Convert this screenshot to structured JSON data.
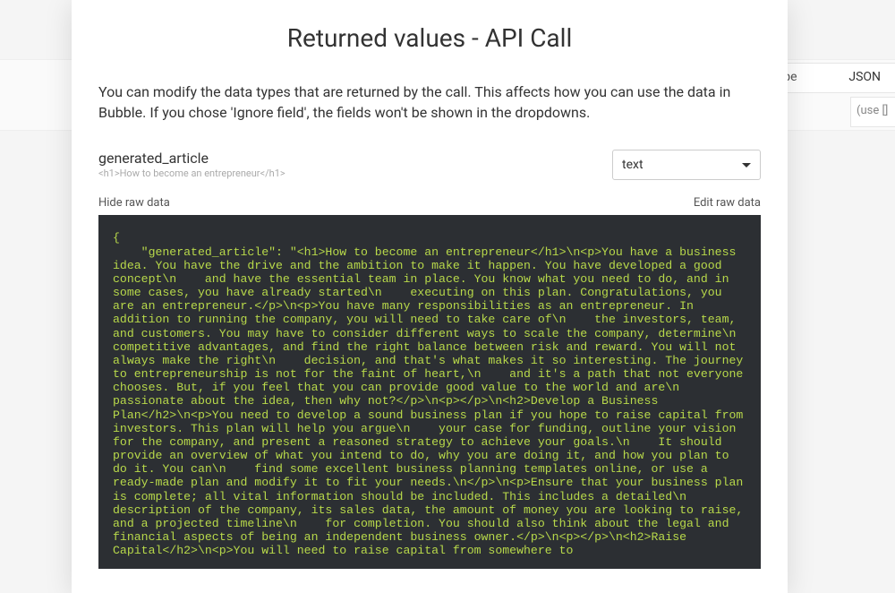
{
  "background": {
    "right_box1_label": "a type",
    "right_box1_value": "JSON",
    "right_box2_text": "(use []"
  },
  "modal": {
    "title": "Returned values - API Call",
    "description": "You can modify the data types that are returned by the call. This affects how you can use the data in Bubble. If you chose 'Ignore field', the fields won't be shown in the dropdowns.",
    "field": {
      "name": "generated_article",
      "preview": "<h1>How to become an entrepreneur</h1>",
      "type_selected": "text"
    },
    "raw_bar": {
      "hide_label": "Hide raw data",
      "edit_label": "Edit raw data"
    },
    "raw_json": "{\n    \"generated_article\": \"<h1>How to become an entrepreneur</h1>\\n<p>You have a business idea. You have the drive and the ambition to make it happen. You have developed a good concept\\n    and have the essential team in place. You know what you need to do, and in some cases, you have already started\\n    executing on this plan. Congratulations, you are an entrepreneur.</p>\\n<p>You have many responsibilities as an entrepreneur. In addition to running the company, you will need to take care of\\n    the investors, team, and customers. You may have to consider different ways to scale the company, determine\\n    competitive advantages, and find the right balance between risk and reward. You will not always make the right\\n    decision, and that's what makes it so interesting. The journey to entrepreneurship is not for the faint of heart,\\n    and it's a path that not everyone chooses. But, if you feel that you can provide good value to the world and are\\n    passionate about the idea, then why not?</p>\\n<p></p>\\n<h2>Develop a Business Plan</h2>\\n<p>You need to develop a sound business plan if you hope to raise capital from investors. This plan will help you argue\\n    your case for funding, outline your vision for the company, and present a reasoned strategy to achieve your goals.\\n    It should provide an overview of what you intend to do, why you are doing it, and how you plan to do it. You can\\n    find some excellent business planning templates online, or use a ready-made plan and modify it to fit your needs.\\n</p>\\n<p>Ensure that your business plan is complete; all vital information should be included. This includes a detailed\\n    description of the company, its sales data, the amount of money you are looking to raise, and a projected timeline\\n    for completion. You should also think about the legal and financial aspects of being an independent business owner.</p>\\n<p></p>\\n<h2>Raise Capital</h2>\\n<p>You will need to raise capital from somewhere to"
  }
}
